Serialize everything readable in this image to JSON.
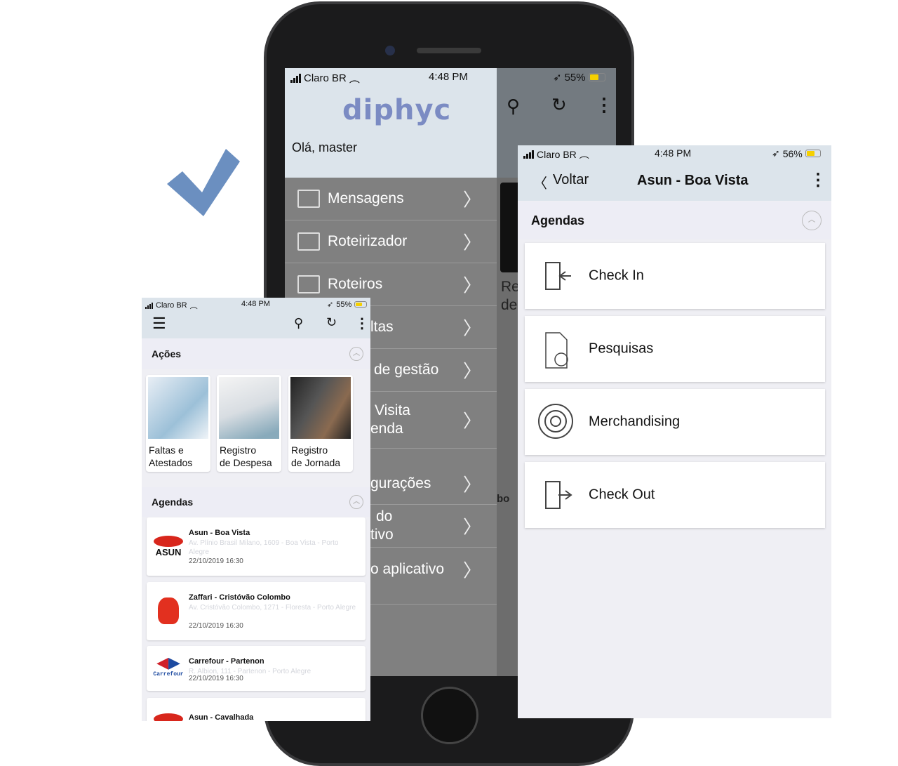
{
  "accent_color": "#6b8fc0",
  "main_phone": {
    "status": {
      "carrier": "Claro BR",
      "time": "4:48 PM",
      "battery": "55%"
    },
    "logo": "diphyc",
    "greeting": "Olá, master",
    "menu": [
      {
        "label": "Mensagens",
        "icon": "envelope-icon"
      },
      {
        "label": "Roteirizador",
        "icon": "map-icon"
      },
      {
        "label": "Roteiros",
        "icon": "map-icon"
      },
      {
        "label": "ltas"
      },
      {
        "label": "de gestão"
      },
      {
        "label": "Visita",
        "label2": "enda"
      },
      {
        "label": "gurações"
      },
      {
        "label": "do",
        "label2": "tivo"
      },
      {
        "label": "o aplicativo"
      }
    ],
    "bg_fragments": {
      "re": "Re",
      "de": "de",
      "bo": "bo"
    }
  },
  "left_screen": {
    "status": {
      "carrier": "Claro BR",
      "time": "4:48 PM",
      "battery": "55%"
    },
    "actions_title": "Ações",
    "actions": [
      {
        "line1": "Faltas e",
        "line2": "Atestados"
      },
      {
        "line1": "Registro",
        "line2": "de Despesa"
      },
      {
        "line1": "Registro",
        "line2": "de Jornada"
      }
    ],
    "agendas_title": "Agendas",
    "agendas": [
      {
        "name": "Asun - Boa Vista",
        "address": "Av. Plínio Brasil Milano, 1609 - Boa Vista - Porto Alegre",
        "date": "22/10/2019 16:30",
        "logo": "ASUN"
      },
      {
        "name": "Zaffari - Cristóvão Colombo",
        "address": "Av. Cristóvão Colombo, 1271 - Floresta - Porto Alegre",
        "date": "22/10/2019 16:30",
        "logo": "zaffari"
      },
      {
        "name": "Carrefour - Partenon",
        "address": "R. Albion, 111 - Partenon - Porto Alegre",
        "date": "22/10/2019 16:30",
        "logo": "Carrefour"
      },
      {
        "name": "Asun - Cavalhada",
        "logo": "ASUN"
      }
    ]
  },
  "right_screen": {
    "status": {
      "carrier": "Claro BR",
      "time": "4:48 PM",
      "battery": "56%"
    },
    "back_label": "Voltar",
    "title": "Asun - Boa Vista",
    "section": "Agendas",
    "items": [
      {
        "label": "Check In",
        "icon": "check-in-icon"
      },
      {
        "label": "Pesquisas",
        "icon": "survey-icon"
      },
      {
        "label": "Merchandising",
        "icon": "target-icon"
      },
      {
        "label": "Check Out",
        "icon": "check-out-icon"
      }
    ]
  }
}
